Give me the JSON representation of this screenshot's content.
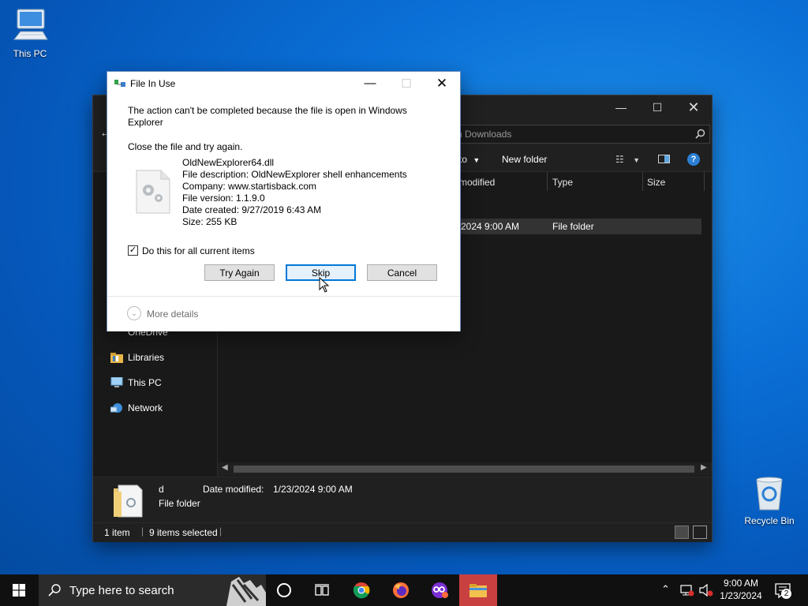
{
  "desktop": {
    "this_pc_label": "This PC",
    "recycle_bin_label": "Recycle Bin"
  },
  "explorer": {
    "search_placeholder": "rch Downloads",
    "toolbar": {
      "move_to_label": "to",
      "new_folder_label": "New folder"
    },
    "columns": {
      "modified": "modified",
      "type": "Type",
      "size": "Size"
    },
    "row": {
      "date": "2024 9:00 AM",
      "type": "File folder"
    },
    "sidebar": [
      {
        "label": "OneDrive",
        "icon": "cloud-icon"
      },
      {
        "label": "Libraries",
        "icon": "libraries-icon"
      },
      {
        "label": "This PC",
        "icon": "computer-icon"
      },
      {
        "label": "Network",
        "icon": "network-icon"
      }
    ],
    "details": {
      "name": "d",
      "kind": "File folder",
      "date_label": "Date modified:",
      "date_value": "1/23/2024 9:00 AM"
    },
    "status": {
      "items": "1 item",
      "selected": "9 items selected"
    }
  },
  "dialog": {
    "title": "File In Use",
    "message": "The action can't be completed because the file is open in Windows Explorer",
    "instruction": "Close the file and try again.",
    "file": {
      "name": "OldNewExplorer64.dll",
      "description": "File description: OldNewExplorer shell enhancements",
      "company": "Company: www.startisback.com",
      "version": "File version: 1.1.9.0",
      "created": "Date created: 9/27/2019 6:43 AM",
      "size": "Size: 255 KB"
    },
    "checkbox_label": "Do this for all current items",
    "checkbox_checked": true,
    "buttons": {
      "try_again": "Try Again",
      "skip": "Skip",
      "cancel": "Cancel"
    },
    "more_details": "More details"
  },
  "taskbar": {
    "search_placeholder": "Type here to search",
    "clock": {
      "time": "9:00 AM",
      "date": "1/23/2024"
    },
    "notification_count": "2"
  },
  "colors": {
    "accent": "#0078d7",
    "explorer_bg": "#191919",
    "taskbar_bg": "#101010"
  }
}
